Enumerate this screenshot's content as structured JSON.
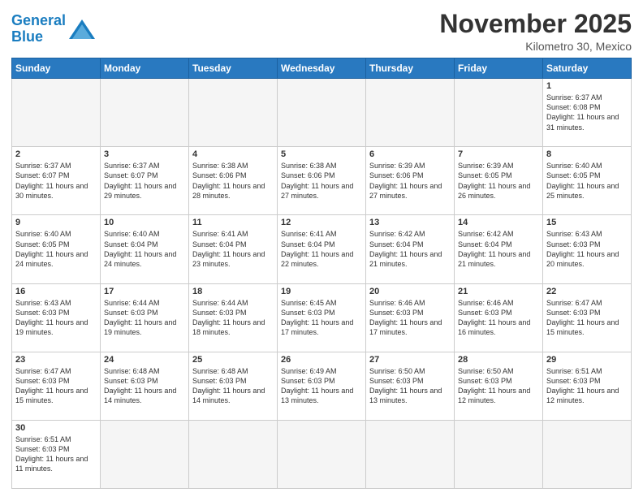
{
  "header": {
    "logo_general": "General",
    "logo_blue": "Blue",
    "month_title": "November 2025",
    "location": "Kilometro 30, Mexico"
  },
  "days_of_week": [
    "Sunday",
    "Monday",
    "Tuesday",
    "Wednesday",
    "Thursday",
    "Friday",
    "Saturday"
  ],
  "weeks": [
    [
      {
        "day": "",
        "empty": true
      },
      {
        "day": "",
        "empty": true
      },
      {
        "day": "",
        "empty": true
      },
      {
        "day": "",
        "empty": true
      },
      {
        "day": "",
        "empty": true
      },
      {
        "day": "",
        "empty": true
      },
      {
        "day": "1",
        "sunrise": "6:37 AM",
        "sunset": "6:08 PM",
        "daylight": "11 hours and 31 minutes."
      }
    ],
    [
      {
        "day": "2",
        "sunrise": "6:37 AM",
        "sunset": "6:07 PM",
        "daylight": "11 hours and 30 minutes."
      },
      {
        "day": "3",
        "sunrise": "6:37 AM",
        "sunset": "6:07 PM",
        "daylight": "11 hours and 29 minutes."
      },
      {
        "day": "4",
        "sunrise": "6:38 AM",
        "sunset": "6:06 PM",
        "daylight": "11 hours and 28 minutes."
      },
      {
        "day": "5",
        "sunrise": "6:38 AM",
        "sunset": "6:06 PM",
        "daylight": "11 hours and 27 minutes."
      },
      {
        "day": "6",
        "sunrise": "6:39 AM",
        "sunset": "6:06 PM",
        "daylight": "11 hours and 27 minutes."
      },
      {
        "day": "7",
        "sunrise": "6:39 AM",
        "sunset": "6:05 PM",
        "daylight": "11 hours and 26 minutes."
      },
      {
        "day": "8",
        "sunrise": "6:40 AM",
        "sunset": "6:05 PM",
        "daylight": "11 hours and 25 minutes."
      }
    ],
    [
      {
        "day": "9",
        "sunrise": "6:40 AM",
        "sunset": "6:05 PM",
        "daylight": "11 hours and 24 minutes."
      },
      {
        "day": "10",
        "sunrise": "6:40 AM",
        "sunset": "6:04 PM",
        "daylight": "11 hours and 24 minutes."
      },
      {
        "day": "11",
        "sunrise": "6:41 AM",
        "sunset": "6:04 PM",
        "daylight": "11 hours and 23 minutes."
      },
      {
        "day": "12",
        "sunrise": "6:41 AM",
        "sunset": "6:04 PM",
        "daylight": "11 hours and 22 minutes."
      },
      {
        "day": "13",
        "sunrise": "6:42 AM",
        "sunset": "6:04 PM",
        "daylight": "11 hours and 21 minutes."
      },
      {
        "day": "14",
        "sunrise": "6:42 AM",
        "sunset": "6:04 PM",
        "daylight": "11 hours and 21 minutes."
      },
      {
        "day": "15",
        "sunrise": "6:43 AM",
        "sunset": "6:03 PM",
        "daylight": "11 hours and 20 minutes."
      }
    ],
    [
      {
        "day": "16",
        "sunrise": "6:43 AM",
        "sunset": "6:03 PM",
        "daylight": "11 hours and 19 minutes."
      },
      {
        "day": "17",
        "sunrise": "6:44 AM",
        "sunset": "6:03 PM",
        "daylight": "11 hours and 19 minutes."
      },
      {
        "day": "18",
        "sunrise": "6:44 AM",
        "sunset": "6:03 PM",
        "daylight": "11 hours and 18 minutes."
      },
      {
        "day": "19",
        "sunrise": "6:45 AM",
        "sunset": "6:03 PM",
        "daylight": "11 hours and 17 minutes."
      },
      {
        "day": "20",
        "sunrise": "6:46 AM",
        "sunset": "6:03 PM",
        "daylight": "11 hours and 17 minutes."
      },
      {
        "day": "21",
        "sunrise": "6:46 AM",
        "sunset": "6:03 PM",
        "daylight": "11 hours and 16 minutes."
      },
      {
        "day": "22",
        "sunrise": "6:47 AM",
        "sunset": "6:03 PM",
        "daylight": "11 hours and 15 minutes."
      }
    ],
    [
      {
        "day": "23",
        "sunrise": "6:47 AM",
        "sunset": "6:03 PM",
        "daylight": "11 hours and 15 minutes."
      },
      {
        "day": "24",
        "sunrise": "6:48 AM",
        "sunset": "6:03 PM",
        "daylight": "11 hours and 14 minutes."
      },
      {
        "day": "25",
        "sunrise": "6:48 AM",
        "sunset": "6:03 PM",
        "daylight": "11 hours and 14 minutes."
      },
      {
        "day": "26",
        "sunrise": "6:49 AM",
        "sunset": "6:03 PM",
        "daylight": "11 hours and 13 minutes."
      },
      {
        "day": "27",
        "sunrise": "6:50 AM",
        "sunset": "6:03 PM",
        "daylight": "11 hours and 13 minutes."
      },
      {
        "day": "28",
        "sunrise": "6:50 AM",
        "sunset": "6:03 PM",
        "daylight": "11 hours and 12 minutes."
      },
      {
        "day": "29",
        "sunrise": "6:51 AM",
        "sunset": "6:03 PM",
        "daylight": "11 hours and 12 minutes."
      }
    ],
    [
      {
        "day": "30",
        "sunrise": "6:51 AM",
        "sunset": "6:03 PM",
        "daylight": "11 hours and 11 minutes."
      },
      {
        "day": "",
        "empty": true
      },
      {
        "day": "",
        "empty": true
      },
      {
        "day": "",
        "empty": true
      },
      {
        "day": "",
        "empty": true
      },
      {
        "day": "",
        "empty": true
      },
      {
        "day": "",
        "empty": true
      }
    ]
  ]
}
